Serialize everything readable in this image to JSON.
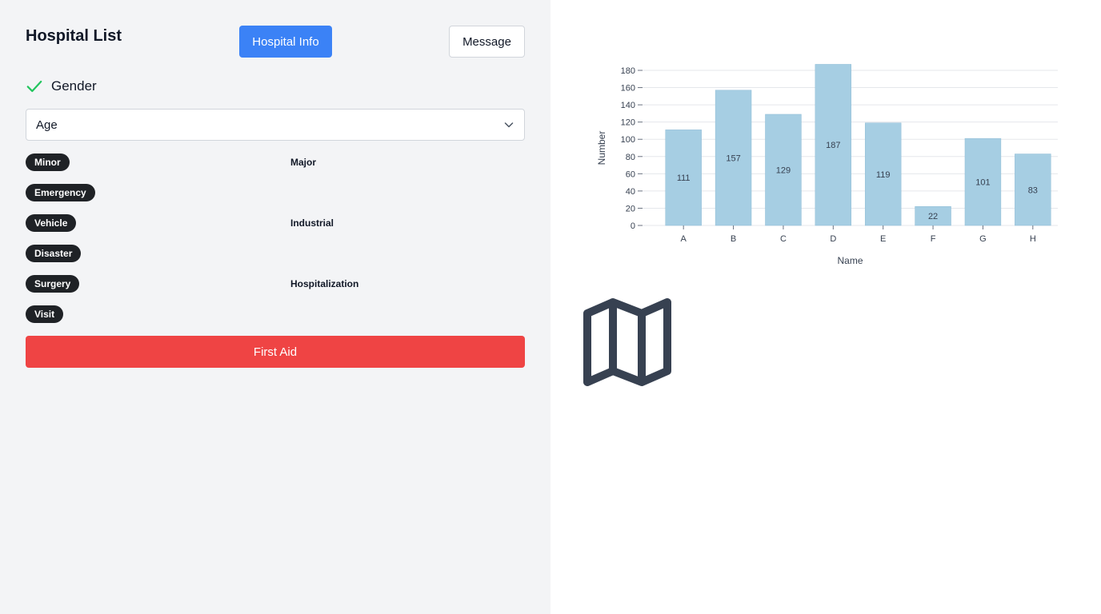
{
  "left": {
    "title": "Hospital List",
    "buttons": {
      "hospital_info": "Hospital Info",
      "message": "Message",
      "first_aid": "First Aid"
    },
    "checkbox": {
      "label": "Gender",
      "checked": true
    },
    "select": {
      "value": "Age",
      "icon": "chevron-down-icon"
    },
    "tags": [
      {
        "label": "Minor",
        "side_label": "Major"
      },
      {
        "label": "Emergency",
        "side_label": ""
      },
      {
        "label": "Vehicle",
        "side_label": "Industrial"
      },
      {
        "label": "Disaster",
        "side_label": ""
      },
      {
        "label": "Surgery",
        "side_label": "Hospitalization"
      },
      {
        "label": "Visit",
        "side_label": ""
      }
    ],
    "colors": {
      "primary": "#3b82f6",
      "danger": "#ef4444",
      "check": "#22c55e",
      "tag_bg": "#1f2226"
    }
  },
  "chart_data": {
    "type": "bar",
    "categories": [
      "A",
      "B",
      "C",
      "D",
      "E",
      "F",
      "G",
      "H"
    ],
    "values": [
      111,
      157,
      129,
      187,
      119,
      22,
      101,
      83
    ],
    "xlabel": "Name",
    "ylabel": "Number",
    "ylim": [
      0,
      180
    ],
    "yticks": [
      0,
      20,
      40,
      60,
      80,
      100,
      120,
      140,
      160,
      180
    ],
    "grid": true,
    "bar_color": "#a6cee3",
    "data_labels": true
  },
  "icons": {
    "map": "map-icon"
  }
}
